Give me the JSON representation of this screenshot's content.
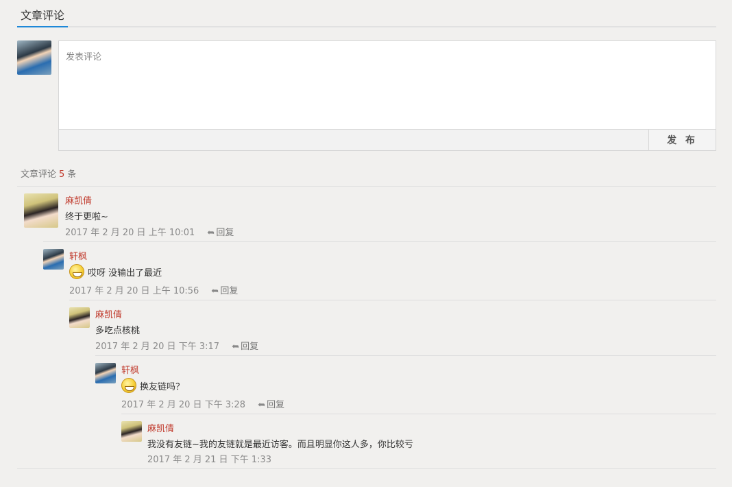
{
  "header": {
    "title": "文章评论"
  },
  "editor": {
    "placeholder": "发表评论",
    "submit_label": "发 布"
  },
  "count": {
    "prefix": "文章评论",
    "value": "5",
    "suffix": "条"
  },
  "reply_label": "回复",
  "comments": [
    {
      "author": "麻凯倩",
      "text": "终于更啦~",
      "time": "2017 年 2 月 20 日 上午 10:01",
      "has_emoji": false,
      "has_reply": true
    },
    {
      "author": "轩枫",
      "text": "哎呀 没输出了最近",
      "time": "2017 年 2 月 20 日 上午 10:56",
      "has_emoji": true,
      "has_reply": true
    },
    {
      "author": "麻凯倩",
      "text": "多吃点核桃",
      "time": "2017 年 2 月 20 日 下午 3:17",
      "has_emoji": false,
      "has_reply": true
    },
    {
      "author": "轩枫",
      "text": "换友链吗？",
      "time": "2017 年 2 月 20 日 下午 3:28",
      "has_emoji": true,
      "has_reply": true
    },
    {
      "author": "麻凯倩",
      "text": "我没有友链~我的友链就是最近访客。而且明显你这人多，你比较亏",
      "time": "2017 年 2 月 21 日 下午 1:33",
      "has_emoji": false,
      "has_reply": false
    }
  ]
}
